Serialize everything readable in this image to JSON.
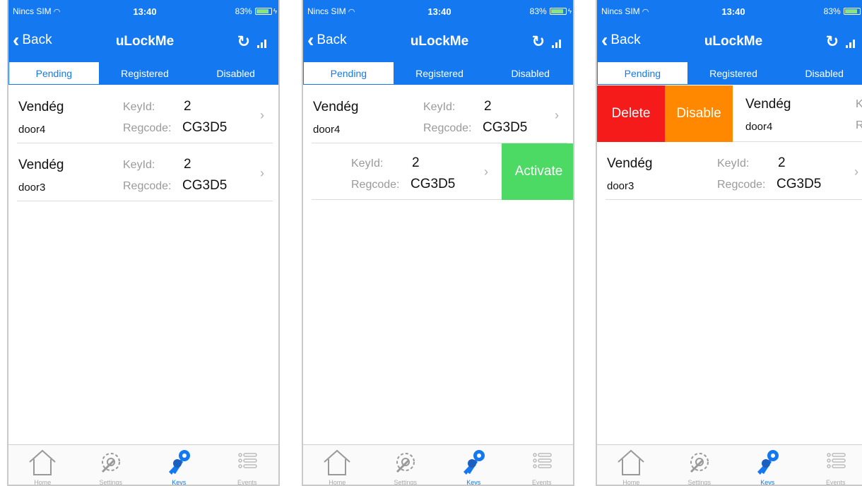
{
  "status": {
    "carrier": "Nincs SIM",
    "time": "13:40",
    "battery": "83%"
  },
  "nav": {
    "back_label": "Back",
    "title": "uLockMe"
  },
  "tabs": [
    "Pending",
    "Registered",
    "Disabled"
  ],
  "tabbar": [
    "Home",
    "Settings",
    "Keys",
    "Events"
  ],
  "colors": {
    "header": "#1479f0",
    "activate": "#4cd964",
    "delete": "#f51b1b",
    "disable": "#ff8800"
  },
  "keys": [
    {
      "name": "Vendég",
      "door": "door4",
      "keyid_label": "KeyId:",
      "keyid": "2",
      "regcode_label": "Regcode:",
      "regcode": "CG3D5"
    },
    {
      "name": "Vendég",
      "door": "door3",
      "keyid_label": "KeyId:",
      "keyid": "2",
      "regcode_label": "Regcode:",
      "regcode": "CG3D5"
    }
  ],
  "swipe_actions": {
    "activate": "Activate",
    "delete": "Delete",
    "disable": "Disable"
  },
  "truncated": {
    "key_prefix": "K",
    "reg_prefix": "R"
  }
}
